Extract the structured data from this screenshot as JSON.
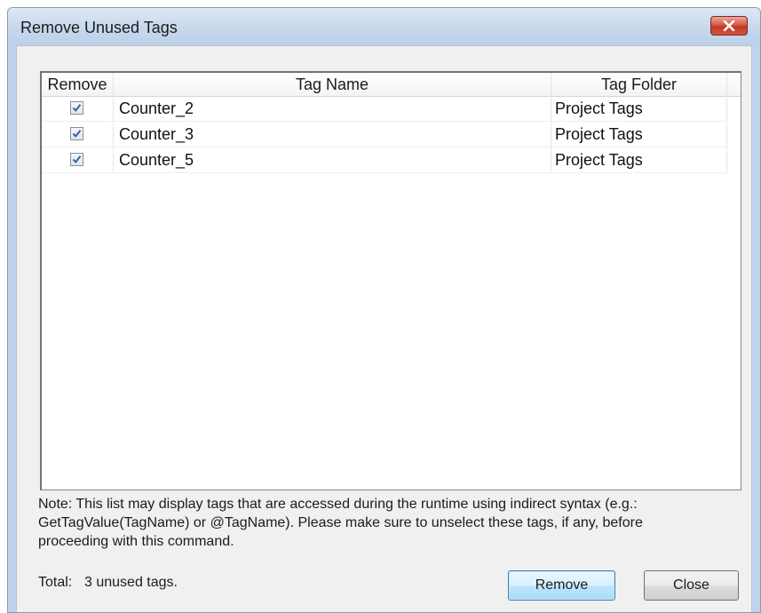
{
  "window": {
    "title": "Remove Unused Tags"
  },
  "columns": {
    "remove": "Remove",
    "tag_name": "Tag Name",
    "tag_folder": "Tag Folder"
  },
  "rows": [
    {
      "checked": true,
      "tag_name": "Counter_2",
      "tag_folder": "Project Tags"
    },
    {
      "checked": true,
      "tag_name": "Counter_3",
      "tag_folder": "Project Tags"
    },
    {
      "checked": true,
      "tag_name": "Counter_5",
      "tag_folder": "Project Tags"
    }
  ],
  "note": {
    "line1": "Note: This list may display tags that are accessed during the runtime using indirect syntax (e.g.:",
    "line2": "GetTagValue(TagName) or @TagName). Please make sure to unselect these tags, if any, before",
    "line3": "proceeding with this command."
  },
  "summary": {
    "label": "Total:",
    "value": "3 unused tags."
  },
  "buttons": {
    "remove": "Remove",
    "close": "Close"
  },
  "icons": {
    "close": "close-icon",
    "check": "checkmark-icon"
  },
  "colors": {
    "titlebar": "#c7d8ed",
    "close_button": "#c23a26",
    "default_button_border": "#3c7fb1"
  }
}
